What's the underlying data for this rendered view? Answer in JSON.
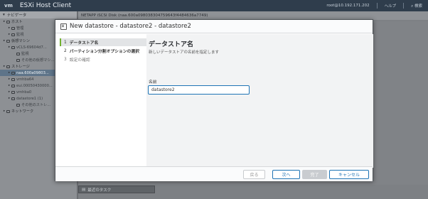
{
  "app": {
    "logo": "vm",
    "title": "ESXi Host Client",
    "user": "root@10.192.171.202",
    "help": "ヘルプ",
    "search": "検索"
  },
  "nav": {
    "header": "ナビゲータ",
    "rows": [
      {
        "label": "ホスト",
        "level": 0
      },
      {
        "label": "管理",
        "level": 1
      },
      {
        "label": "監視",
        "level": 1
      },
      {
        "label": "仮想マシン",
        "level": 0
      },
      {
        "label": "vCLS-69604d7...",
        "level": 1
      },
      {
        "label": "監視",
        "level": 2
      },
      {
        "label": "その他の仮想マシ...",
        "level": 2
      },
      {
        "label": "ストレージ",
        "level": 0
      },
      {
        "label": "naa.600a09803...",
        "level": 1,
        "selected": true
      },
      {
        "label": "vmhba64",
        "level": 1
      },
      {
        "label": "eui.00050430000...",
        "level": 1
      },
      {
        "label": "vmhba0",
        "level": 1
      },
      {
        "label": "datastore1 (1)",
        "level": 1
      },
      {
        "label": "その他のストレ...",
        "level": 2
      },
      {
        "label": "ネットワーク",
        "level": 0
      }
    ]
  },
  "main": {
    "header": "NETAPP iSCSI Disk (naa.600a098038304759643f4484636a7749)"
  },
  "tasks": {
    "label": "最近のタスク"
  },
  "modal": {
    "title": "New datastore - datastore2 - datastore2",
    "steps": [
      {
        "num": "1",
        "label": "データストア名",
        "state": "active"
      },
      {
        "num": "2",
        "label": "パーティション分割オプションの選択",
        "state": "bold"
      },
      {
        "num": "3",
        "label": "設定の確認",
        "state": "muted"
      }
    ],
    "content": {
      "title": "データストア名",
      "description": "新しいデータストアの名前を指定します",
      "name_label": "名前",
      "name_value": "datastore2"
    },
    "buttons": {
      "back": "戻る",
      "next": "次へ",
      "finish": "完了",
      "cancel": "キャンセル"
    }
  },
  "colors": {
    "accent": "#1f74b5",
    "step_indicator": "#71b02f",
    "topbar": "#2f3d4c"
  }
}
